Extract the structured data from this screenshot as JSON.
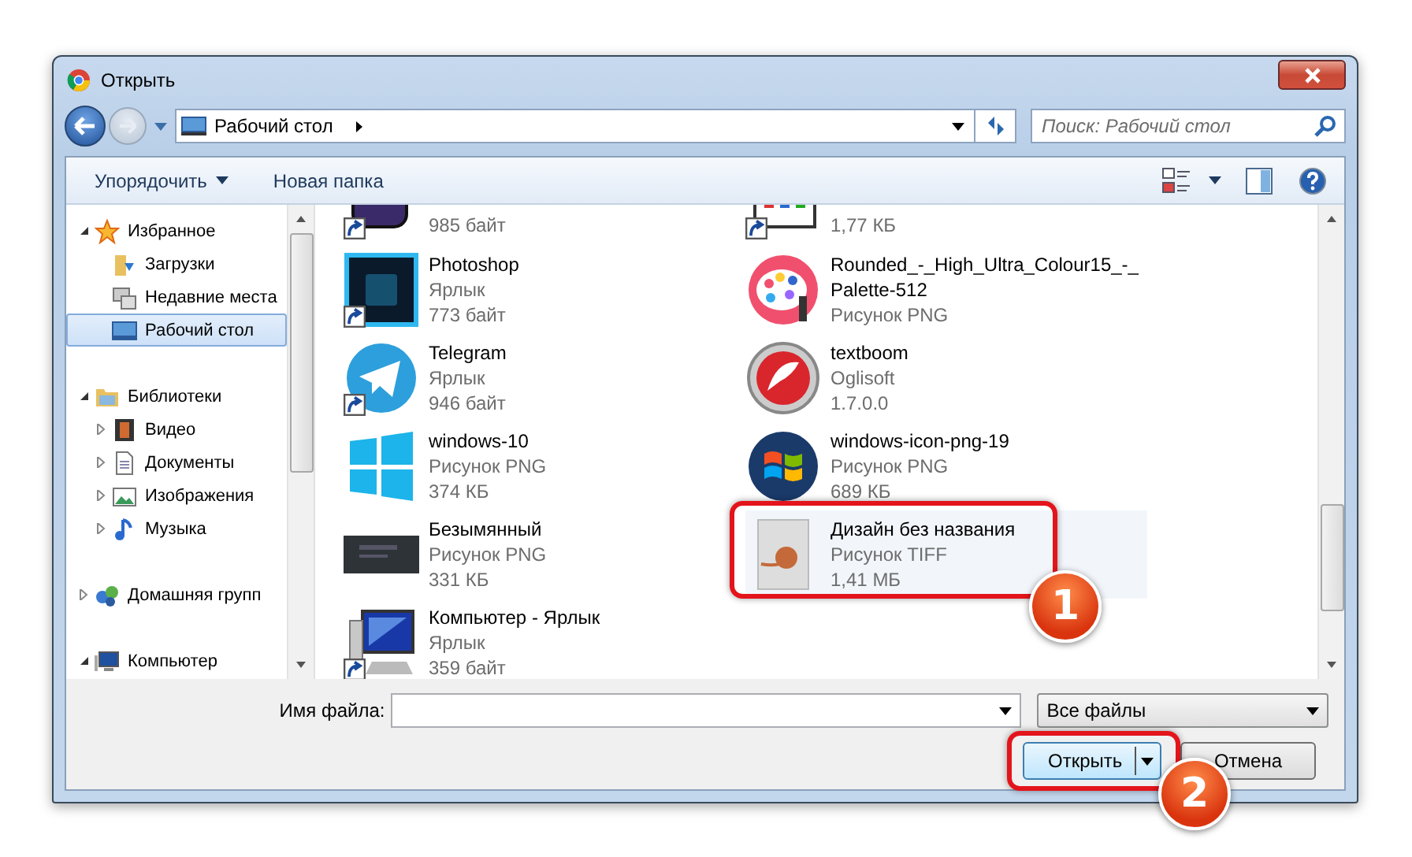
{
  "window": {
    "title": "Открыть"
  },
  "navigation": {
    "address": "Рабочий стол",
    "search": {
      "placeholder": "Поиск: Рабочий стол"
    }
  },
  "toolbar": {
    "buttons": [
      {
        "label": "Упорядочить",
        "has_menu": true
      },
      {
        "label": "Новая папка",
        "has_menu": false
      }
    ]
  },
  "sidebar": {
    "groups": [
      {
        "label": "Избранное",
        "kind": "favorites",
        "expanded": true,
        "selected": false,
        "children": [
          {
            "label": "Загрузки",
            "kind": "downloads",
            "selected": false
          },
          {
            "label": "Недавние места",
            "kind": "recent",
            "selected": false
          },
          {
            "label": "Рабочий стол",
            "kind": "desktop",
            "selected": true
          }
        ]
      },
      {
        "label": "Библиотеки",
        "kind": "libraries",
        "expanded": true,
        "selected": false,
        "children": [
          {
            "label": "Видео",
            "kind": "video",
            "selected": false,
            "expanded": false
          },
          {
            "label": "Документы",
            "kind": "documents",
            "selected": false,
            "expanded": false
          },
          {
            "label": "Изображения",
            "kind": "pictures",
            "selected": false,
            "expanded": false
          },
          {
            "label": "Музыка",
            "kind": "music",
            "selected": false,
            "expanded": false
          }
        ]
      },
      {
        "label": "Домашняя групп",
        "kind": "homegroup",
        "expanded": false,
        "selected": false
      },
      {
        "label": "Компьютер",
        "kind": "computer",
        "expanded": true,
        "selected": false
      }
    ]
  },
  "files": {
    "columns": [
      [
        {
          "kind": "app-shortcut",
          "details": [
            "985 байт"
          ],
          "shortcut": true,
          "partial": true,
          "selected": false
        },
        {
          "kind": "photoshop",
          "name": [
            "Photoshop"
          ],
          "details": [
            "Ярлык",
            "773 байт"
          ],
          "shortcut": true,
          "partial": false,
          "selected": false
        },
        {
          "kind": "telegram",
          "name": [
            "Telegram"
          ],
          "details": [
            "Ярлык",
            "946 байт"
          ],
          "shortcut": true,
          "partial": false,
          "selected": false
        },
        {
          "kind": "tiles",
          "name": [
            "windows-10"
          ],
          "details": [
            "Рисунок PNG",
            "374 КБ"
          ],
          "shortcut": false,
          "partial": false,
          "selected": false
        },
        {
          "kind": "screenshot",
          "name": [
            "Безымянный"
          ],
          "details": [
            "Рисунок PNG",
            "331 КБ"
          ],
          "shortcut": false,
          "partial": false,
          "selected": false
        },
        {
          "kind": "computer",
          "name": [
            "Компьютер - Ярлык"
          ],
          "details": [
            "Ярлык",
            "359 байт"
          ],
          "shortcut": true,
          "partial": false,
          "selected": false
        }
      ],
      [
        {
          "kind": "archive",
          "details": [
            "1,77 КБ"
          ],
          "shortcut": true,
          "partial": true,
          "selected": false
        },
        {
          "kind": "palette",
          "name": [
            "Rounded_-_High_Ultra_Colour15_-_",
            "Palette-512"
          ],
          "details": [
            "Рисунок PNG"
          ],
          "shortcut": false,
          "partial": false,
          "selected": false
        },
        {
          "kind": "textboom",
          "name": [
            "textboom"
          ],
          "details": [
            "Oglisoft",
            "1.7.0.0"
          ],
          "shortcut": false,
          "partial": false,
          "selected": false
        },
        {
          "kind": "windows-logo",
          "name": [
            "windows-icon-png-19"
          ],
          "details": [
            "Рисунок PNG",
            "689 КБ"
          ],
          "shortcut": false,
          "partial": false,
          "selected": false
        },
        {
          "kind": "thumbnail",
          "name": [
            "Дизайн без названия"
          ],
          "details": [
            "Рисунок TIFF",
            "1,41 МБ"
          ],
          "shortcut": false,
          "partial": false,
          "selected": true
        }
      ]
    ]
  },
  "bottom": {
    "filename": {
      "label": "Имя файла:"
    },
    "filter": "Все файлы",
    "buttons": [
      {
        "label": "Открыть",
        "kind": "split"
      },
      {
        "label": "Отмена",
        "kind": "plain"
      }
    ]
  },
  "callouts": [
    {
      "number": "1"
    },
    {
      "number": "2"
    }
  ]
}
